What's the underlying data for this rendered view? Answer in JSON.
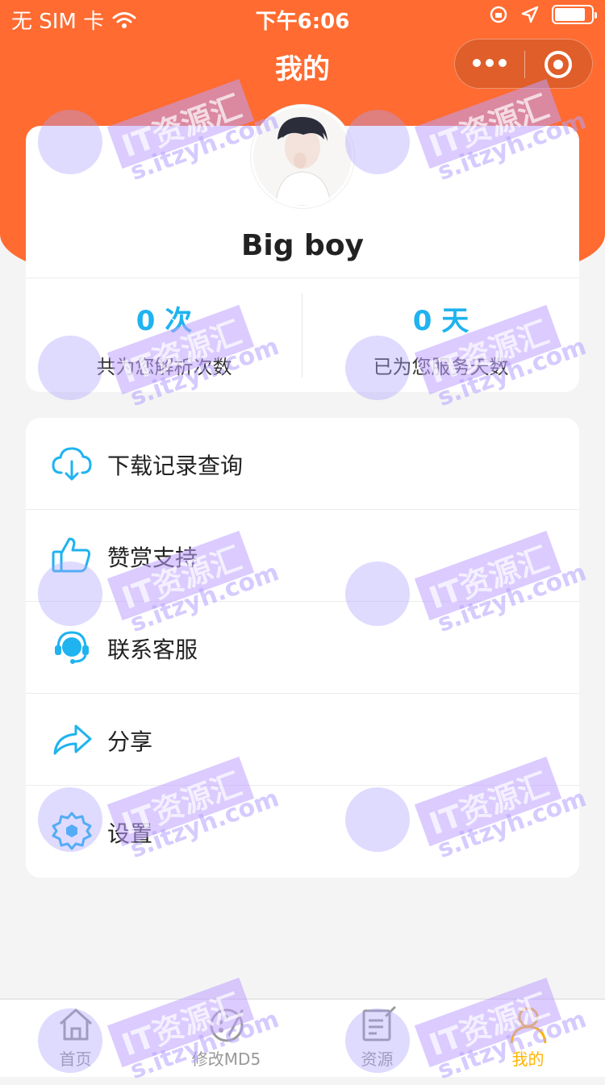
{
  "status_bar": {
    "carrier": "无 SIM 卡",
    "time": "下午6:06"
  },
  "nav": {
    "title": "我的"
  },
  "profile": {
    "username": "Big boy"
  },
  "stats": [
    {
      "value": "0 次",
      "label": "共为您解析次数"
    },
    {
      "value": "0 天",
      "label": "已为您服务天数"
    }
  ],
  "menu": [
    {
      "label": "下载记录查询",
      "icon": "cloud-download-icon"
    },
    {
      "label": "赞赏支持",
      "icon": "thumbs-up-icon"
    },
    {
      "label": "联系客服",
      "icon": "headset-icon"
    },
    {
      "label": "分享",
      "icon": "share-icon"
    },
    {
      "label": "设置",
      "icon": "gear-icon"
    }
  ],
  "tabbar": [
    {
      "label": "首页",
      "icon": "home-icon"
    },
    {
      "label": "修改MD5",
      "icon": "palette-icon"
    },
    {
      "label": "资源",
      "icon": "document-edit-icon"
    },
    {
      "label": "我的",
      "icon": "user-icon",
      "active": true
    }
  ],
  "watermark": {
    "brand": "IT资源汇",
    "url": "s.itzyh.com"
  },
  "colors": {
    "header": "#ff6b30",
    "accent": "#1fb3ef",
    "tab_active": "#ffb400",
    "tab_inactive": "#999999"
  }
}
